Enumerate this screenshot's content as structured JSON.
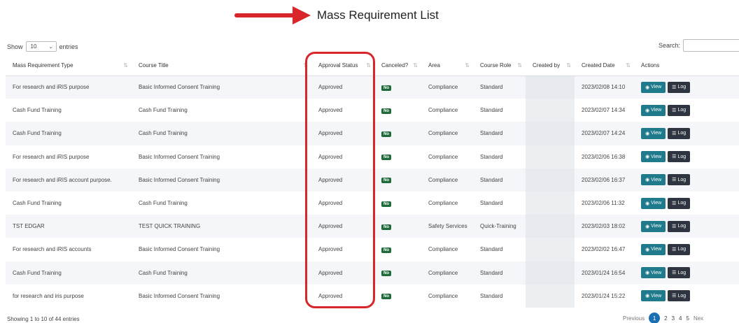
{
  "header": {
    "title": "Mass Requirement List"
  },
  "controls": {
    "show_label": "Show",
    "page_length": "10",
    "entries_label": "entries",
    "search_label": "Search:",
    "search_value": ""
  },
  "table": {
    "columns": [
      "Mass Requirement Type",
      "Course Title",
      "Approval Status",
      "Canceled?",
      "Area",
      "Course Role",
      "Created by",
      "Created Date",
      "Actions"
    ],
    "rows": [
      {
        "type": "For research and iRIS purpose",
        "course": "Basic Informed Consent Training",
        "status": "Approved",
        "canceled": "No",
        "area": "Compliance",
        "role": "Standard",
        "created_by": "",
        "date": "2023/02/08 14:10"
      },
      {
        "type": "Cash Fund Training",
        "course": "Cash Fund Training",
        "status": "Approved",
        "canceled": "No",
        "area": "Compliance",
        "role": "Standard",
        "created_by": "",
        "date": "2023/02/07 14:34"
      },
      {
        "type": "Cash Fund Training",
        "course": "Cash Fund Training",
        "status": "Approved",
        "canceled": "No",
        "area": "Compliance",
        "role": "Standard",
        "created_by": "",
        "date": "2023/02/07 14:24"
      },
      {
        "type": "For research and iRIS purpose",
        "course": "Basic Informed Consent Training",
        "status": "Approved",
        "canceled": "No",
        "area": "Compliance",
        "role": "Standard",
        "created_by": "",
        "date": "2023/02/06 16:38"
      },
      {
        "type": "For research and iRIS account purpose.",
        "course": "Basic Informed Consent Training",
        "status": "Approved",
        "canceled": "No",
        "area": "Compliance",
        "role": "Standard",
        "created_by": "",
        "date": "2023/02/06 16:37"
      },
      {
        "type": "Cash Fund Training",
        "course": "Cash Fund Training",
        "status": "Approved",
        "canceled": "No",
        "area": "Compliance",
        "role": "Standard",
        "created_by": "",
        "date": "2023/02/06 11:32"
      },
      {
        "type": "TST EDGAR",
        "course": "TEST QUICK TRAINING",
        "status": "Approved",
        "canceled": "No",
        "area": "Safety Services",
        "role": "Quick-Training",
        "created_by": "",
        "date": "2023/02/03 18:02"
      },
      {
        "type": "For research and iRIS accounts",
        "course": "Basic Informed Consent Training",
        "status": "Approved",
        "canceled": "No",
        "area": "Compliance",
        "role": "Standard",
        "created_by": "",
        "date": "2023/02/02 16:47"
      },
      {
        "type": "Cash Fund Training",
        "course": "Cash Fund Training",
        "status": "Approved",
        "canceled": "No",
        "area": "Compliance",
        "role": "Standard",
        "created_by": "",
        "date": "2023/01/24 16:54"
      },
      {
        "type": "for research and iris purpose",
        "course": "Basic Informed Consent Training",
        "status": "Approved",
        "canceled": "No",
        "area": "Compliance",
        "role": "Standard",
        "created_by": "",
        "date": "2023/01/24 15:22"
      }
    ],
    "actions": {
      "view_label": "View",
      "log_label": "Log"
    }
  },
  "footer": {
    "info": "Showing 1 to 10 of 44 entries",
    "previous": "Previous",
    "pages": [
      "1",
      "2",
      "3",
      "4",
      "5"
    ],
    "next": "Nex",
    "active_page": "1"
  },
  "colors": {
    "view_button": "#1f7a8c",
    "log_button": "#2e3440",
    "badge_no": "#1e6b3a",
    "highlight": "#d9262b",
    "active_page": "#1a6fb3"
  },
  "icons": {
    "arrow": "red-arrow-annotation-icon",
    "view": "eye-icon",
    "log": "list-icon",
    "sort": "sort-icon",
    "dropdown": "chevron-down-icon"
  }
}
